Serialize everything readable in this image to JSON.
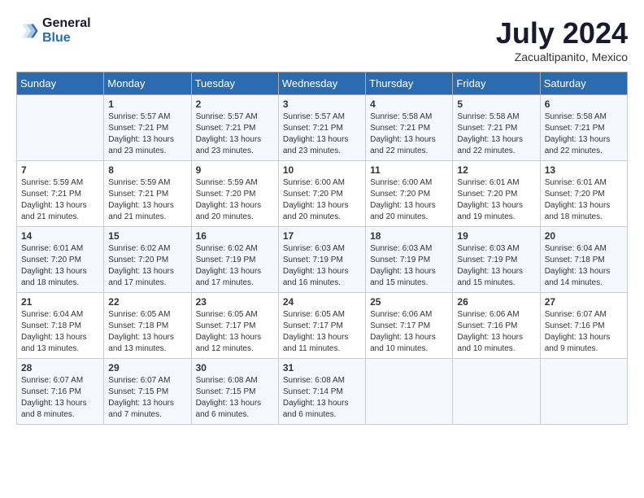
{
  "header": {
    "logo_line1": "General",
    "logo_line2": "Blue",
    "month_year": "July 2024",
    "location": "Zacualtipanito, Mexico"
  },
  "weekdays": [
    "Sunday",
    "Monday",
    "Tuesday",
    "Wednesday",
    "Thursday",
    "Friday",
    "Saturday"
  ],
  "weeks": [
    [
      {
        "day": "",
        "info": ""
      },
      {
        "day": "1",
        "info": "Sunrise: 5:57 AM\nSunset: 7:21 PM\nDaylight: 13 hours\nand 23 minutes."
      },
      {
        "day": "2",
        "info": "Sunrise: 5:57 AM\nSunset: 7:21 PM\nDaylight: 13 hours\nand 23 minutes."
      },
      {
        "day": "3",
        "info": "Sunrise: 5:57 AM\nSunset: 7:21 PM\nDaylight: 13 hours\nand 23 minutes."
      },
      {
        "day": "4",
        "info": "Sunrise: 5:58 AM\nSunset: 7:21 PM\nDaylight: 13 hours\nand 22 minutes."
      },
      {
        "day": "5",
        "info": "Sunrise: 5:58 AM\nSunset: 7:21 PM\nDaylight: 13 hours\nand 22 minutes."
      },
      {
        "day": "6",
        "info": "Sunrise: 5:58 AM\nSunset: 7:21 PM\nDaylight: 13 hours\nand 22 minutes."
      }
    ],
    [
      {
        "day": "7",
        "info": "Sunrise: 5:59 AM\nSunset: 7:21 PM\nDaylight: 13 hours\nand 21 minutes."
      },
      {
        "day": "8",
        "info": "Sunrise: 5:59 AM\nSunset: 7:21 PM\nDaylight: 13 hours\nand 21 minutes."
      },
      {
        "day": "9",
        "info": "Sunrise: 5:59 AM\nSunset: 7:20 PM\nDaylight: 13 hours\nand 20 minutes."
      },
      {
        "day": "10",
        "info": "Sunrise: 6:00 AM\nSunset: 7:20 PM\nDaylight: 13 hours\nand 20 minutes."
      },
      {
        "day": "11",
        "info": "Sunrise: 6:00 AM\nSunset: 7:20 PM\nDaylight: 13 hours\nand 20 minutes."
      },
      {
        "day": "12",
        "info": "Sunrise: 6:01 AM\nSunset: 7:20 PM\nDaylight: 13 hours\nand 19 minutes."
      },
      {
        "day": "13",
        "info": "Sunrise: 6:01 AM\nSunset: 7:20 PM\nDaylight: 13 hours\nand 18 minutes."
      }
    ],
    [
      {
        "day": "14",
        "info": "Sunrise: 6:01 AM\nSunset: 7:20 PM\nDaylight: 13 hours\nand 18 minutes."
      },
      {
        "day": "15",
        "info": "Sunrise: 6:02 AM\nSunset: 7:20 PM\nDaylight: 13 hours\nand 17 minutes."
      },
      {
        "day": "16",
        "info": "Sunrise: 6:02 AM\nSunset: 7:19 PM\nDaylight: 13 hours\nand 17 minutes."
      },
      {
        "day": "17",
        "info": "Sunrise: 6:03 AM\nSunset: 7:19 PM\nDaylight: 13 hours\nand 16 minutes."
      },
      {
        "day": "18",
        "info": "Sunrise: 6:03 AM\nSunset: 7:19 PM\nDaylight: 13 hours\nand 15 minutes."
      },
      {
        "day": "19",
        "info": "Sunrise: 6:03 AM\nSunset: 7:19 PM\nDaylight: 13 hours\nand 15 minutes."
      },
      {
        "day": "20",
        "info": "Sunrise: 6:04 AM\nSunset: 7:18 PM\nDaylight: 13 hours\nand 14 minutes."
      }
    ],
    [
      {
        "day": "21",
        "info": "Sunrise: 6:04 AM\nSunset: 7:18 PM\nDaylight: 13 hours\nand 13 minutes."
      },
      {
        "day": "22",
        "info": "Sunrise: 6:05 AM\nSunset: 7:18 PM\nDaylight: 13 hours\nand 13 minutes."
      },
      {
        "day": "23",
        "info": "Sunrise: 6:05 AM\nSunset: 7:17 PM\nDaylight: 13 hours\nand 12 minutes."
      },
      {
        "day": "24",
        "info": "Sunrise: 6:05 AM\nSunset: 7:17 PM\nDaylight: 13 hours\nand 11 minutes."
      },
      {
        "day": "25",
        "info": "Sunrise: 6:06 AM\nSunset: 7:17 PM\nDaylight: 13 hours\nand 10 minutes."
      },
      {
        "day": "26",
        "info": "Sunrise: 6:06 AM\nSunset: 7:16 PM\nDaylight: 13 hours\nand 10 minutes."
      },
      {
        "day": "27",
        "info": "Sunrise: 6:07 AM\nSunset: 7:16 PM\nDaylight: 13 hours\nand 9 minutes."
      }
    ],
    [
      {
        "day": "28",
        "info": "Sunrise: 6:07 AM\nSunset: 7:16 PM\nDaylight: 13 hours\nand 8 minutes."
      },
      {
        "day": "29",
        "info": "Sunrise: 6:07 AM\nSunset: 7:15 PM\nDaylight: 13 hours\nand 7 minutes."
      },
      {
        "day": "30",
        "info": "Sunrise: 6:08 AM\nSunset: 7:15 PM\nDaylight: 13 hours\nand 6 minutes."
      },
      {
        "day": "31",
        "info": "Sunrise: 6:08 AM\nSunset: 7:14 PM\nDaylight: 13 hours\nand 6 minutes."
      },
      {
        "day": "",
        "info": ""
      },
      {
        "day": "",
        "info": ""
      },
      {
        "day": "",
        "info": ""
      }
    ]
  ]
}
